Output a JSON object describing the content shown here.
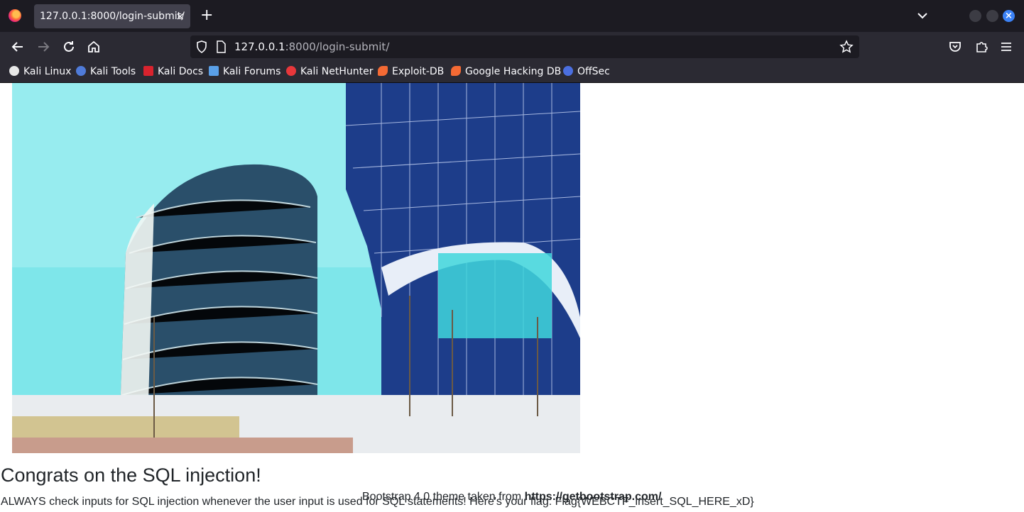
{
  "browser": {
    "tab_title": "127.0.0.1:8000/login-submit/",
    "tab_close": "×",
    "new_tab": "+",
    "url_host": "127.0.0.1",
    "url_path": ":8000/login-submit/",
    "window_close": "×"
  },
  "bookmarks": [
    {
      "label": "Kali Linux",
      "icon": "kali-dragon-icon",
      "color": "#e8e8e8"
    },
    {
      "label": "Kali Tools",
      "icon": "kali-tools-icon",
      "color": "#4f7bd9"
    },
    {
      "label": "Kali Docs",
      "icon": "kali-docs-icon",
      "color": "#d9232e"
    },
    {
      "label": "Kali Forums",
      "icon": "kali-forums-icon",
      "color": "#5aa0e8"
    },
    {
      "label": "Kali NetHunter",
      "icon": "kali-nethunter-icon",
      "color": "#e8373b"
    },
    {
      "label": "Exploit-DB",
      "icon": "exploit-db-icon",
      "color": "#f46a34"
    },
    {
      "label": "Google Hacking DB",
      "icon": "ghdb-icon",
      "color": "#f46a34"
    },
    {
      "label": "OffSec",
      "icon": "offsec-icon",
      "color": "#4b6fe0"
    }
  ],
  "page": {
    "heading": "Congrats on the SQL injection!",
    "message": "ALWAYS check inputs for SQL injection whenever the user input is used for SQL statements! Here's your flag: Flag{WEBCTF_insert_SQL_HERE_xD}",
    "footer_prefix": "Bootstrap 4.0 theme taken from ",
    "footer_link": "https://getbootstrap.com/"
  },
  "colors": {
    "chrome_dark": "#1c1b22",
    "chrome": "#2b2a33",
    "tab_active": "#42414d",
    "close_accent": "#3b82f6"
  }
}
